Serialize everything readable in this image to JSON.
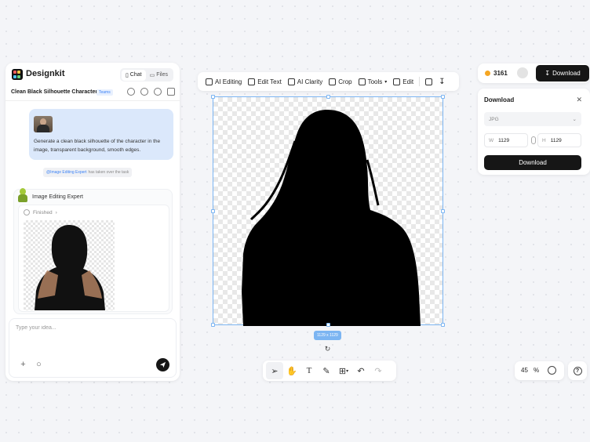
{
  "app": {
    "name": "Designkit"
  },
  "left_panel": {
    "tabs": [
      {
        "label": "Chat",
        "icon": "chat-icon",
        "active": true
      },
      {
        "label": "Files",
        "icon": "folder-icon",
        "active": false
      }
    ],
    "conversation_title": "Clean Black Silhouette Character",
    "team_badge": "Teams",
    "user_message": "Generate a clean black silhouette of the character in the image, transparent background, smooth edges.",
    "handoff": {
      "mention": "@Image Editing Expert",
      "text": "has taken over the task"
    },
    "agent": {
      "name": "Image Editing Expert",
      "status": "Finished"
    },
    "input": {
      "placeholder": "Type your idea...",
      "value": ""
    }
  },
  "toolbar": {
    "items": [
      {
        "label": "AI Editing",
        "icon": "ai-edit-icon"
      },
      {
        "label": "Edit Text",
        "icon": "text-box-icon"
      },
      {
        "label": "AI Clarity",
        "icon": "clarity-icon"
      },
      {
        "label": "Crop",
        "icon": "crop-icon"
      },
      {
        "label": "Tools",
        "icon": "grid-icon"
      },
      {
        "label": "Edit",
        "icon": "sliders-icon"
      }
    ]
  },
  "canvas": {
    "size_label": "1129 x 1129"
  },
  "account": {
    "credits": "3161",
    "download_label": "Download"
  },
  "download_panel": {
    "title": "Download",
    "format": "JPG",
    "width_label": "W",
    "width": "1129",
    "height_label": "H",
    "height": "1129",
    "button": "Download"
  },
  "zoom": {
    "value": "45",
    "unit": "%"
  },
  "colors": {
    "accent_blue": "#7cb5f2",
    "primary_dark": "#161616",
    "user_bubble": "#dbe8fb"
  }
}
